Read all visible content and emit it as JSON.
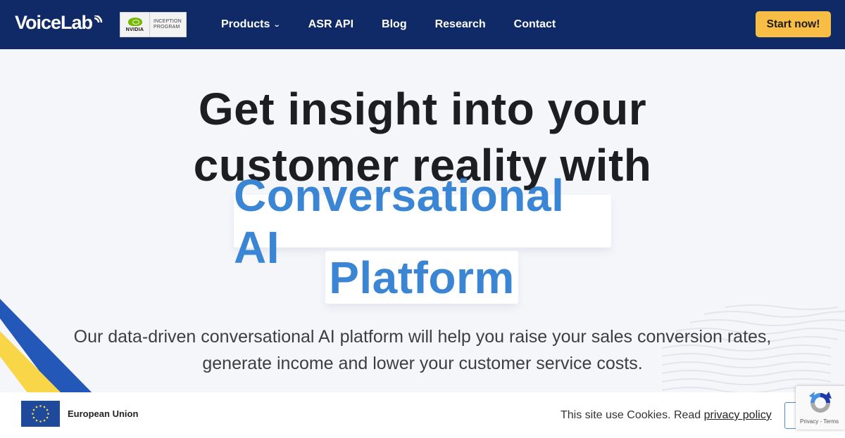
{
  "header": {
    "logo_text": "VoiceLab",
    "nvidia_badge": {
      "brand": "NVIDIA",
      "line1": "INCEPTION",
      "line2": "PROGRAM"
    },
    "nav": [
      {
        "label": "Products",
        "has_dropdown": true
      },
      {
        "label": "ASR API"
      },
      {
        "label": "Blog"
      },
      {
        "label": "Research"
      },
      {
        "label": "Contact"
      }
    ],
    "cta_label": "Start now!",
    "colors": {
      "background": "#0f2a66",
      "cta": "#f7bd45"
    }
  },
  "hero": {
    "headline_line1": "Get insight into your",
    "headline_line2": "customer reality with",
    "highlight_line1": "Conversational AI",
    "highlight_line2": "Platform",
    "subtext_line1": "Our data-driven conversational AI platform will help you raise your sales conversion rates,",
    "subtext_line2": "generate income and lower your customer service costs.",
    "colors": {
      "highlight": "#3a86d4",
      "headline": "#1c1e21",
      "stripe_blue": "#2458b8",
      "stripe_yellow": "#f8d647"
    }
  },
  "cookie_bar": {
    "eu_label": "European Union",
    "text": "This site use Cookies. Read ",
    "link_label": "privacy policy"
  },
  "recaptcha": {
    "privacy_label": "Privacy",
    "separator": "-",
    "terms_label": "Terms"
  }
}
